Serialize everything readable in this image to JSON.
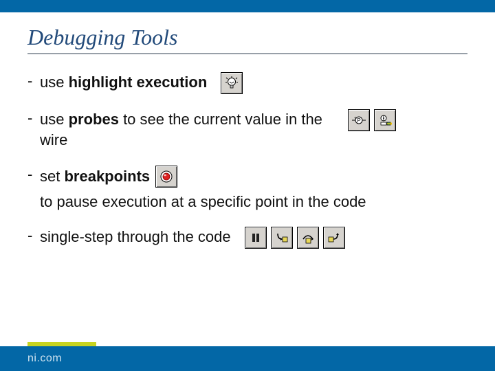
{
  "title": "Debugging Tools",
  "bullets": {
    "b1_pre": "use ",
    "b1_strong": "highlight execution",
    "b2_pre": "use ",
    "b2_strong": "probes",
    "b2_post": " to see the current value in the wire",
    "b3_pre": "set ",
    "b3_strong": "breakpoints",
    "b3_post": " to pause execution at a specific point in the code",
    "b4": "single-step through the code"
  },
  "footer": {
    "brand": "ni.com"
  }
}
